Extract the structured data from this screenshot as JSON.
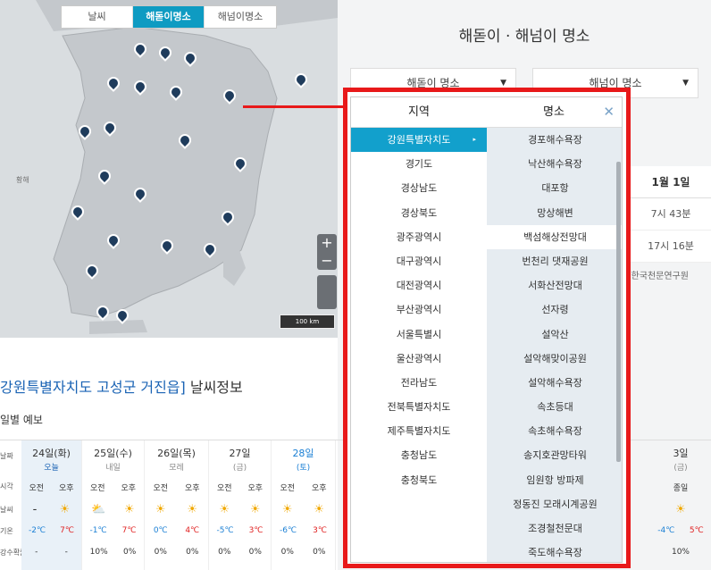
{
  "map": {
    "tabs": [
      {
        "label": "날씨"
      },
      {
        "label": "해돋이명소"
      },
      {
        "label": "해넘이명소"
      }
    ],
    "sea_label": "황해",
    "zoom_in": "+",
    "zoom_out": "−",
    "scale": "100 km"
  },
  "panel": {
    "title": "해돋이 · 해넘이 명소",
    "sunrise_select": "해돋이 명소",
    "sunset_select": "해넘이 명소",
    "table_header": "1월 1일",
    "sunrise_time": "7시 43분",
    "sunset_time": "17시 16분",
    "source": ": 한국천문연구원"
  },
  "popup": {
    "region_header": "지역",
    "place_header": "명소",
    "close": "✕",
    "regions": [
      "강원특별자치도",
      "경기도",
      "경상남도",
      "경상북도",
      "광주광역시",
      "대구광역시",
      "대전광역시",
      "부산광역시",
      "서울특별시",
      "울산광역시",
      "전라남도",
      "전북특별자치도",
      "제주특별자치도",
      "충청남도",
      "충청북도"
    ],
    "active_region_marker": "▸",
    "places": [
      "경포해수욕장",
      "낙산해수욕장",
      "대포항",
      "망상해변",
      "백섬해상전망대",
      "번천리 댓재공원",
      "서화산전망대",
      "선자령",
      "설악산",
      "설악해맞이공원",
      "설악해수욕장",
      "속초등대",
      "속초해수욕장",
      "송지호관망타워",
      "임원항 방파제",
      "정동진 모래시계공원",
      "조경철천문대",
      "죽도해수욕장"
    ]
  },
  "weather": {
    "title_location": "강원특별자치도 고성군 거진읍]",
    "title_rest": " 날씨정보",
    "subtitle": "일별 예보",
    "row_labels": [
      "날짜",
      "시각",
      "날씨",
      "기온",
      "강수확률"
    ],
    "ampm": [
      "오전",
      "오후"
    ],
    "days": [
      {
        "date": "24일(화)",
        "sub": "오늘",
        "am_icon": "-",
        "pm_icon": "☀",
        "lo": "-2℃",
        "hi": "7℃",
        "rain_am": "-",
        "rain_pm": "-"
      },
      {
        "date": "25일(수)",
        "sub": "내일",
        "am_icon": "⛅",
        "pm_icon": "☀",
        "lo": "-1℃",
        "hi": "7℃",
        "rain_am": "10%",
        "rain_pm": "0%"
      },
      {
        "date": "26일(목)",
        "sub": "모레",
        "am_icon": "☀",
        "pm_icon": "☀",
        "lo": "0℃",
        "hi": "4℃",
        "rain_am": "0%",
        "rain_pm": "0%"
      },
      {
        "date": "27일",
        "sub": "(금)",
        "am_icon": "☀",
        "pm_icon": "☀",
        "lo": "-5℃",
        "hi": "3℃",
        "rain_am": "0%",
        "rain_pm": "0%"
      },
      {
        "date": "28일",
        "sub": "(토)",
        "am_icon": "☀",
        "pm_icon": "☀",
        "lo": "-6℃",
        "hi": "3℃",
        "rain_am": "0%",
        "rain_pm": "0%"
      },
      {
        "date": "3일",
        "sub": "(금)",
        "am_icon": "☀",
        "pm_icon": "",
        "lo": "-4℃",
        "hi": "5℃",
        "rain_am": "10%",
        "rain_pm": ""
      }
    ],
    "last_col_ampm": "종일"
  }
}
